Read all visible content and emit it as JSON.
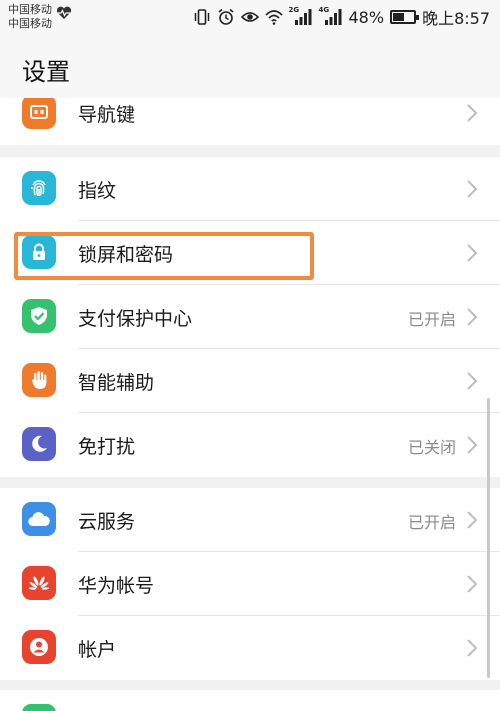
{
  "status_bar": {
    "carrier_1": "中国移动",
    "carrier_2": "中国移动",
    "sig1_tag": "2G",
    "sig2_tag": "4G",
    "battery_percent": "48%",
    "battery_level": 0.48,
    "time": "晚上8:57",
    "icons": [
      "heartbeat-icon",
      "vibrate-icon",
      "alarm-icon",
      "eye-icon",
      "wifi-icon",
      "signal-icon",
      "signal-icon",
      "battery-icon"
    ]
  },
  "header": {
    "title": "设置"
  },
  "groups": [
    {
      "items": [
        {
          "label": "导航键",
          "value": "",
          "icon": "navigation-key-icon",
          "color": "#f07a2b"
        }
      ]
    },
    {
      "items": [
        {
          "label": "指纹",
          "value": "",
          "icon": "fingerprint-icon",
          "color": "#28b7d6"
        },
        {
          "label": "锁屏和密码",
          "value": "",
          "icon": "lock-icon",
          "color": "#28b7d6"
        },
        {
          "label": "支付保护中心",
          "value": "已开启",
          "icon": "shield-check-icon",
          "color": "#35c26e"
        },
        {
          "label": "智能辅助",
          "value": "",
          "icon": "hand-icon",
          "color": "#f07a2b"
        },
        {
          "label": "免打扰",
          "value": "已关闭",
          "icon": "moon-icon",
          "color": "#5b62c6"
        }
      ]
    },
    {
      "items": [
        {
          "label": "云服务",
          "value": "已开启",
          "icon": "cloud-icon",
          "color": "#3e8fe6"
        },
        {
          "label": "华为帐号",
          "value": "",
          "icon": "huawei-logo-icon",
          "color": "#e8432f"
        },
        {
          "label": "帐户",
          "value": "",
          "icon": "user-icon",
          "color": "#e8432f"
        }
      ]
    }
  ],
  "colors": {
    "highlight": "#ef8c3f",
    "accent_text": "#8a8a8a"
  }
}
